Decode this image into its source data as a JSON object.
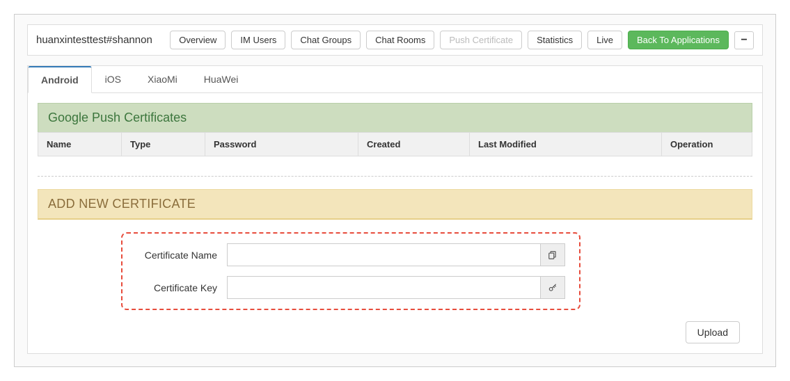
{
  "app_name": "huanxintesttest#shannon",
  "nav": {
    "overview": "Overview",
    "im_users": "IM Users",
    "chat_groups": "Chat Groups",
    "chat_rooms": "Chat Rooms",
    "push_certificate": "Push Certificate",
    "statistics": "Statistics",
    "live": "Live",
    "back": "Back To Applications"
  },
  "tabs": {
    "android": "Android",
    "ios": "iOS",
    "xiaomi": "XiaoMi",
    "huawei": "HuaWei"
  },
  "sections": {
    "list_title": "Google Push Certificates",
    "add_title": "ADD NEW CERTIFICATE"
  },
  "table": {
    "cols": {
      "name": "Name",
      "type": "Type",
      "password": "Password",
      "created": "Created",
      "last_modified": "Last Modified",
      "operation": "Operation"
    }
  },
  "form": {
    "cert_name_label": "Certificate Name",
    "cert_name_value": "",
    "cert_key_label": "Certificate Key",
    "cert_key_value": ""
  },
  "footer": {
    "upload": "Upload"
  }
}
